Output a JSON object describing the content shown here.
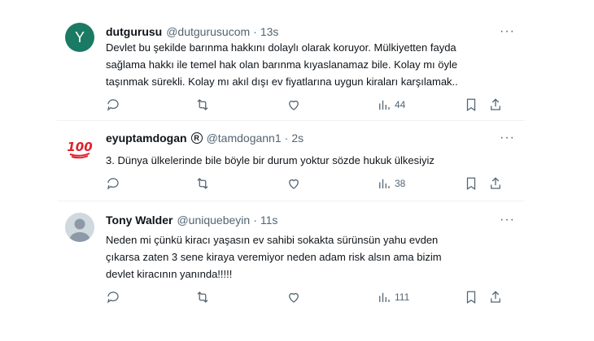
{
  "tweets": [
    {
      "avatar_letter": "Y",
      "name": "dutgurusu",
      "handle": "@dutgurusucom",
      "time": "13s",
      "text_lines": [
        "Devlet bu şekilde barınma hakkını dolaylı olarak koruyor. Mülkiyetten fayda",
        "sağlama hakkı ile temel hak olan barınma kıyaslanamaz bile. Kolay mı öyle",
        "taşınmak sürekli. Kolay mı akıl dışı ev fiyatlarına uygun kiraları karşılamak.."
      ],
      "views": "44"
    },
    {
      "avatar_emoji": "💯",
      "name": "eyuptamdogan",
      "verified_glyph": "R",
      "handle": "@tamdogann1",
      "time": "2s",
      "text_lines": [
        "3. Dünya ülkelerinde bile böyle bir durum yoktur sözde hukuk ülkesiyiz"
      ],
      "views": "38"
    },
    {
      "name": "Tony Walder",
      "handle": "@uniquebeyin",
      "time": "11s",
      "text_lines": [
        "Neden mi çünkü kiracı yaşasın ev sahibi sokakta sürünsün yahu evden",
        "çıkarsa zaten 3 sene kiraya veremiyor neden adam risk alsın ama bizim",
        "devlet kiracının yanında!!!!!"
      ],
      "views": "111"
    }
  ],
  "separator": "·",
  "more_glyph": "···",
  "icons": [
    "reply-icon",
    "retweet-icon",
    "like-icon",
    "views-icon",
    "bookmark-icon",
    "share-icon"
  ],
  "colors": {
    "text": "#0f1419",
    "muted": "#536471",
    "avatar_y_bg": "#1a7a63",
    "divider": "#eff3f4"
  }
}
